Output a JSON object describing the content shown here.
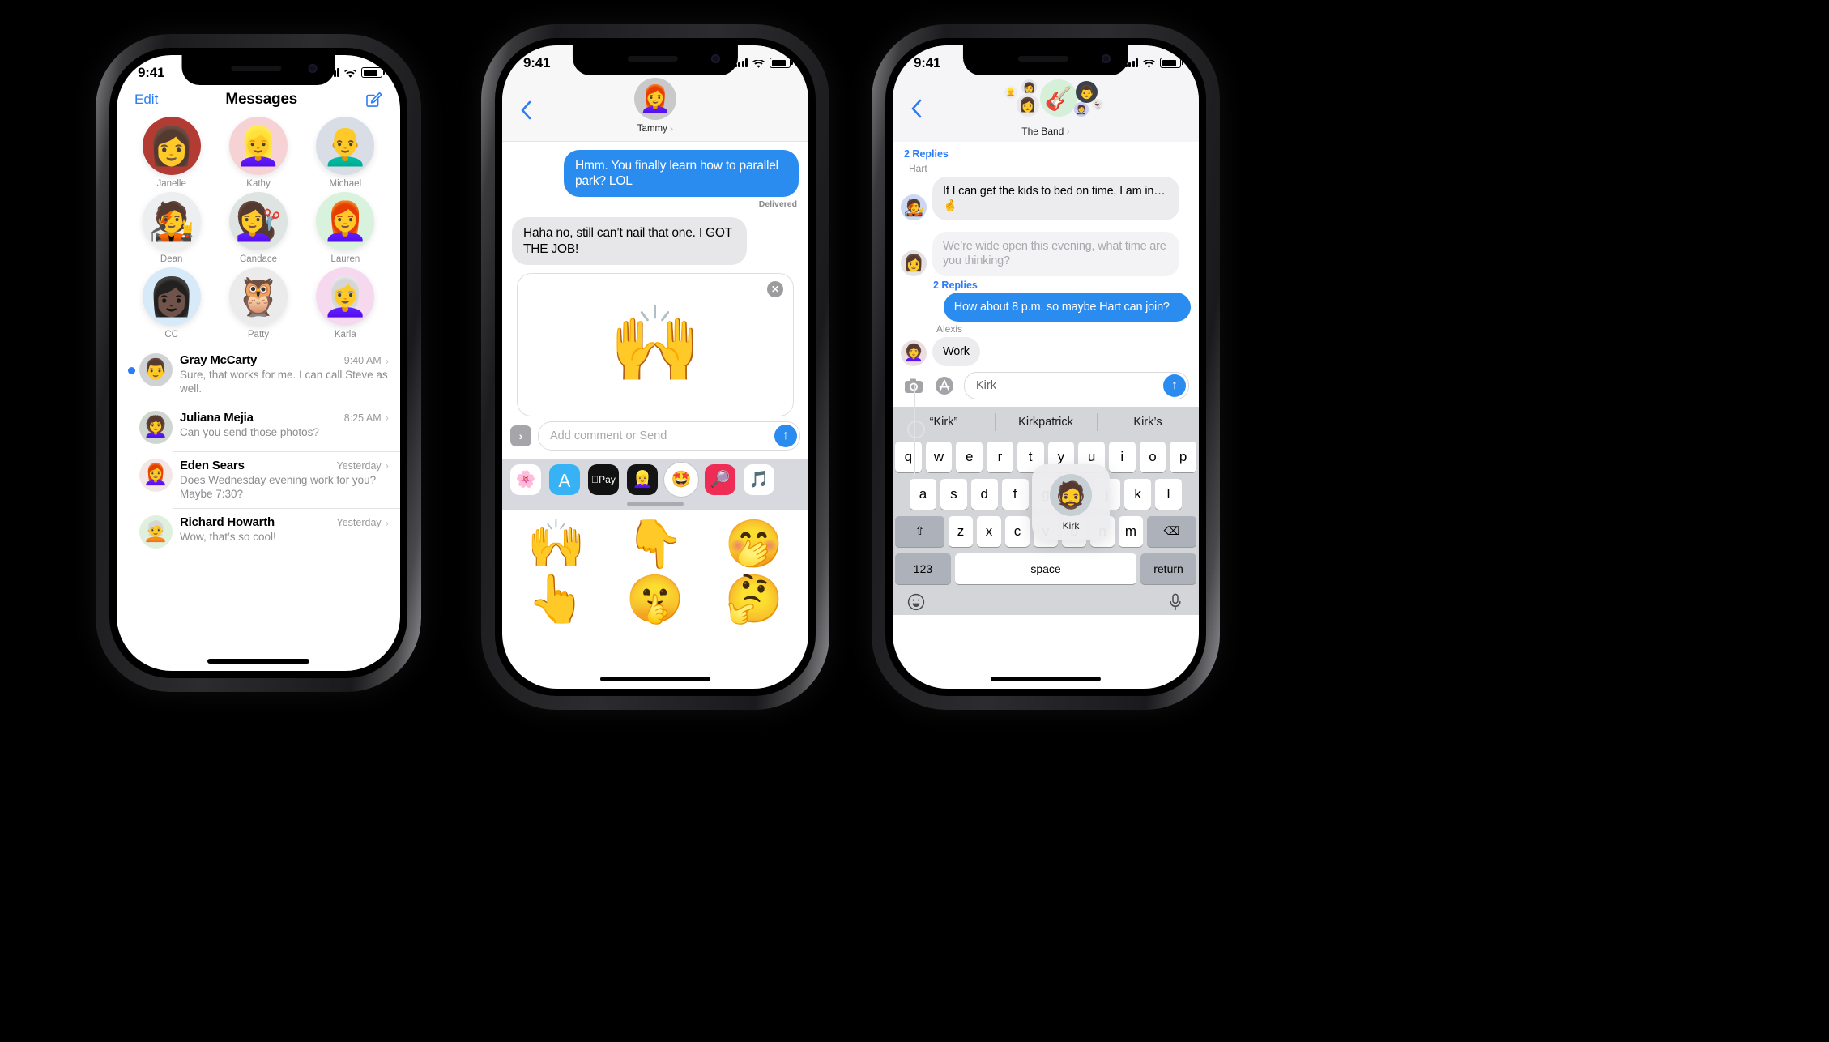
{
  "phone1": {
    "status": {
      "time": "9:41"
    },
    "nav": {
      "edit_label": "Edit",
      "title": "Messages",
      "compose_icon": "compose-icon"
    },
    "contacts": [
      {
        "name": "Janelle",
        "glyph": "👩",
        "bg": "#b23c33"
      },
      {
        "name": "Kathy",
        "glyph": "👱‍♀️",
        "bg": "#f6d2d4"
      },
      {
        "name": "Michael",
        "glyph": "👨‍🦲",
        "bg": "#d9dde6"
      },
      {
        "name": "Dean",
        "glyph": "🧑‍🎤",
        "bg": "#eceef0"
      },
      {
        "name": "Candace",
        "glyph": "💇‍♀️",
        "bg": "#dde4e2"
      },
      {
        "name": "Lauren",
        "glyph": "👩‍🦰",
        "bg": "#d9f2dd"
      },
      {
        "name": "CC",
        "glyph": "👩🏿",
        "bg": "#d7eaf9"
      },
      {
        "name": "Patty",
        "glyph": "🦉",
        "bg": "#ebebeb"
      },
      {
        "name": "Karla",
        "glyph": "👩‍🦳",
        "bg": "#f6d9ef"
      }
    ],
    "conversations": [
      {
        "name": "Gray McCarty",
        "preview": "Sure, that works for me. I can call Steve as well.",
        "time": "9:40 AM",
        "unread": true,
        "glyph": "👨",
        "bg": "#cfd3d6"
      },
      {
        "name": "Juliana Mejia",
        "preview": "Can you send those photos?",
        "time": "8:25 AM",
        "unread": false,
        "glyph": "👩‍🦱",
        "bg": "#cfd6cf"
      },
      {
        "name": "Eden Sears",
        "preview": "Does Wednesday evening work for you? Maybe 7:30?",
        "time": "Yesterday",
        "unread": false,
        "glyph": "👩‍🦰",
        "bg": "#f2e7e6"
      },
      {
        "name": "Richard Howarth",
        "preview": "Wow, that’s so cool!",
        "time": "Yesterday",
        "unread": false,
        "glyph": "🧑‍🦳",
        "bg": "#dff0dd"
      }
    ],
    "chevron": "›"
  },
  "phone2": {
    "status": {
      "time": "9:41"
    },
    "nav": {
      "back_icon": "chevron-left-icon",
      "peer_name": "Tammy",
      "peer_chevron": "›",
      "peer_glyph": "👩‍🦰",
      "peer_bg": "#c9c9cc"
    },
    "messages": [
      {
        "from": "me",
        "text": "Hmm. You finally learn how to parallel park? LOL"
      },
      {
        "from": "them",
        "text": "Haha no, still can’t nail that one. I GOT THE JOB!"
      }
    ],
    "delivered_label": "Delivered",
    "sticker_card": {
      "memoji": "🙌",
      "close_icon": "close-icon"
    },
    "input": {
      "expand_icon": "›",
      "placeholder": "Add comment or Send",
      "send_icon": "↑"
    },
    "app_drawer": [
      {
        "name": "photos-app-icon",
        "glyph": "🌸",
        "bg": "#ffffff",
        "selected": false
      },
      {
        "name": "appstore-app-icon",
        "glyph": "Ａ",
        "bg": "#37b3f5",
        "selected": false
      },
      {
        "name": "applepay-app-icon",
        "glyph": "Pay",
        "bg": "#111111",
        "selected": false
      },
      {
        "name": "animoji-app-icon",
        "glyph": "👱‍♀️",
        "bg": "#141414",
        "selected": false
      },
      {
        "name": "memoji-app-icon",
        "glyph": "🤩",
        "bg": "#ffffff",
        "selected": true
      },
      {
        "name": "images-app-icon",
        "glyph": "🔎",
        "bg": "#ee2c56",
        "selected": false
      },
      {
        "name": "music-app-icon",
        "glyph": "🎵",
        "bg": "#ffffff",
        "selected": false
      }
    ],
    "stickers": [
      "🙌",
      "👇",
      "🤭",
      "👆",
      "🤫",
      "🤔"
    ]
  },
  "phone3": {
    "status": {
      "time": "9:41"
    },
    "nav": {
      "back_icon": "chevron-left-icon",
      "group_name": "The Band",
      "group_chevron": "›",
      "group_glyph": "🎸",
      "group_bg": "#d5efd8"
    },
    "replies_label_1": "2 Replies",
    "replies_label_2": "2 Replies",
    "messages": [
      {
        "sender": "Hart",
        "text": "If I can get the kids to bed on time, I am in… 🤞",
        "from": "them",
        "glyph": "🧑‍🎤",
        "bg": "#ccd8f2"
      },
      {
        "sender": "",
        "text": "We’re wide open this evening, what time are you thinking?",
        "from": "ghost",
        "glyph": "👩",
        "bg": "#e3e3e5"
      },
      {
        "sender": "",
        "text": "How about 8 p.m. so maybe Hart can join?",
        "from": "me",
        "glyph": "",
        "bg": ""
      },
      {
        "sender": "Alexis",
        "text": "Work",
        "from": "them",
        "glyph": "👩‍🦱",
        "bg": "#e9dfe2"
      }
    ],
    "mention_popup": {
      "name": "Kirk",
      "glyph": "🧔",
      "bg": "#c8cfd4"
    },
    "input": {
      "camera_icon": "camera-icon",
      "appstore_icon": "appstore-icon",
      "value": "Kirk",
      "send_icon": "↑"
    },
    "suggestions": [
      "“Kirk”",
      "Kirkpatrick",
      "Kirk’s"
    ],
    "keyboard": {
      "row1": [
        "q",
        "w",
        "e",
        "r",
        "t",
        "y",
        "u",
        "i",
        "o",
        "p"
      ],
      "row2": [
        "a",
        "s",
        "d",
        "f",
        "g",
        "h",
        "j",
        "k",
        "l"
      ],
      "row3": [
        "z",
        "x",
        "c",
        "v",
        "b",
        "n",
        "m"
      ],
      "shift_label": "⇧",
      "backspace_label": "⌫",
      "numeric_label": "123",
      "space_label": "space",
      "return_label": "return",
      "emoji_icon": "emoji-icon",
      "mic_icon": "microphone-icon"
    }
  },
  "theme": {
    "imessage_blue": "#2b8cf0",
    "tint_blue": "#2b7cf6",
    "bubble_gray": "#e7e7e9",
    "keyboard_bg": "#d3d5d9"
  }
}
